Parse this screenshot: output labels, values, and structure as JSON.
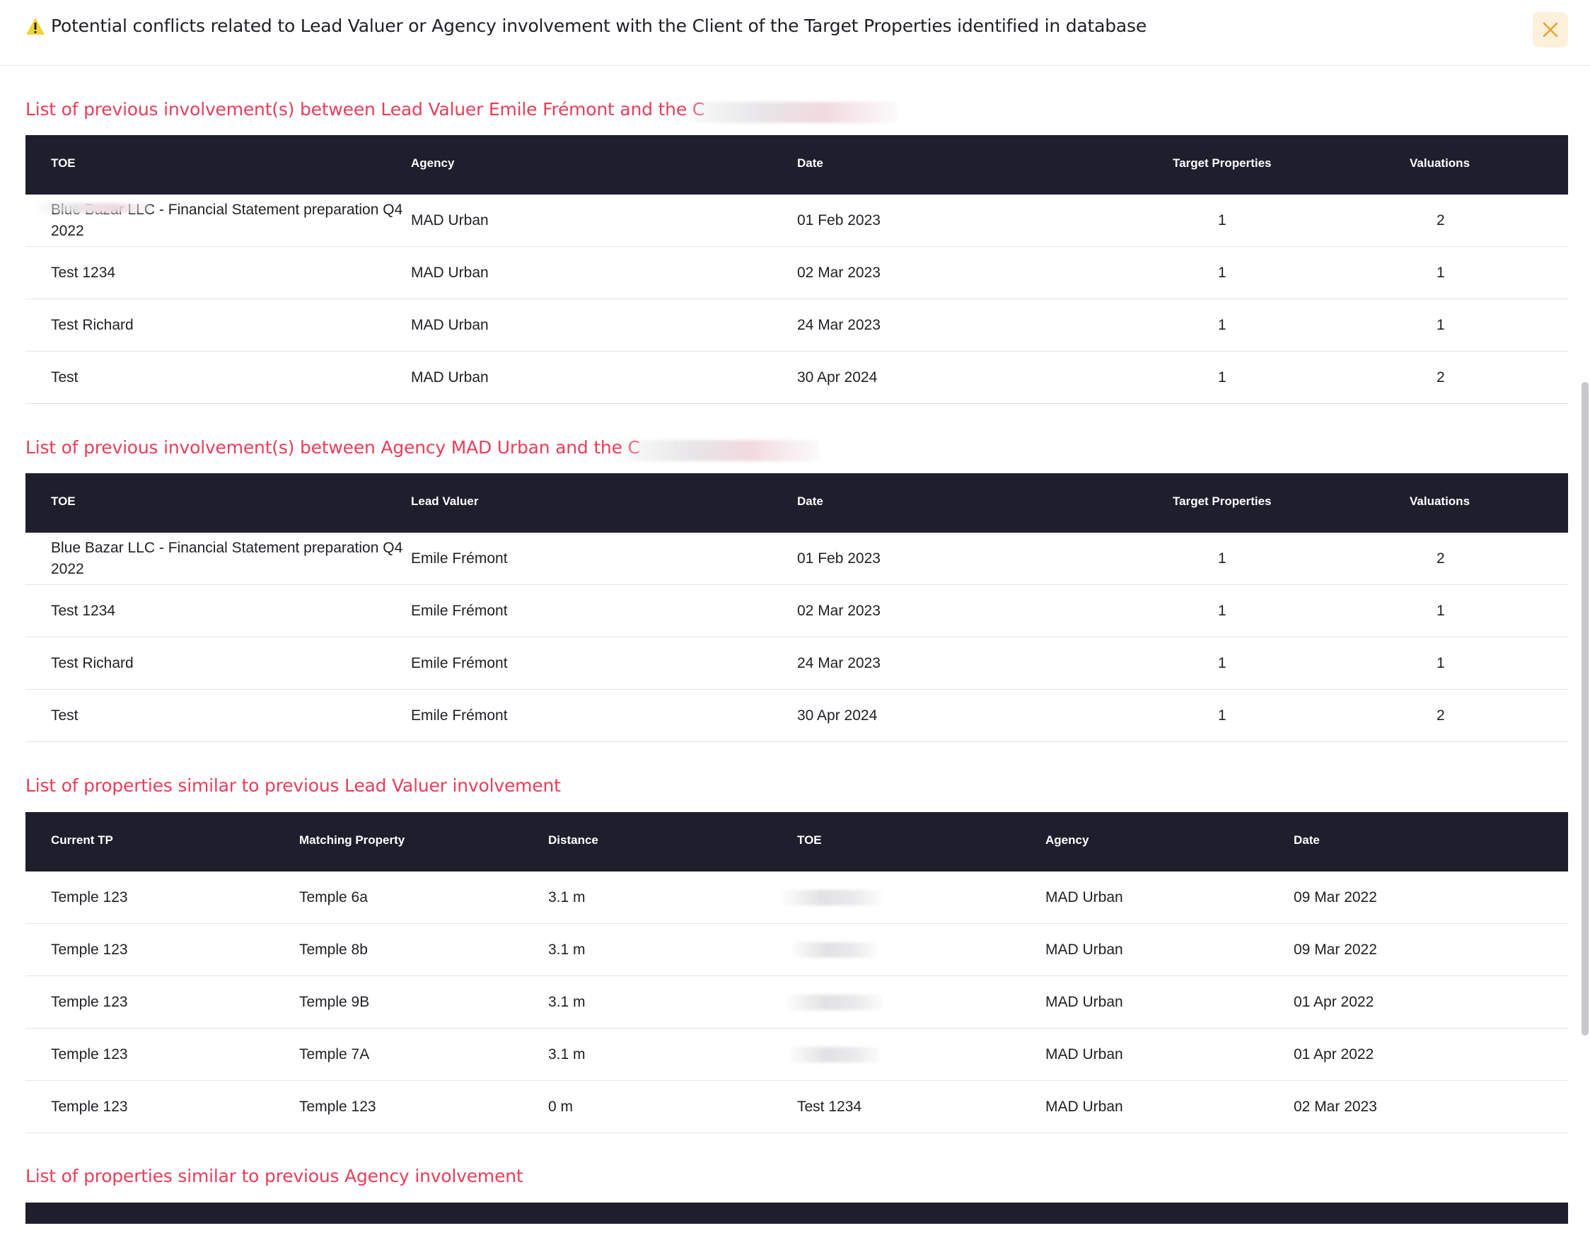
{
  "header": {
    "title": "Potential conflicts related to Lead Valuer or Agency involvement with the Client of the Target Properties identified in database",
    "warning_color": "#f2c94c",
    "close_icon": "close-icon",
    "accent": "#f2a02b"
  },
  "sections": {
    "valuer_involvement": {
      "title": "List of previous involvement(s) between Lead Valuer Emile Frémont and the C",
      "columns": [
        "TOE",
        "Agency",
        "Date",
        "Target Properties",
        "Valuations"
      ],
      "rows": [
        {
          "toe_line1": "Blue Bazar LLC - Financial Statement preparation Q4",
          "toe_line2": "2022",
          "agency": "MAD Urban",
          "date": "01 Feb 2023",
          "target_properties": "1",
          "valuations": "2"
        },
        {
          "toe": "Test 1234",
          "agency": "MAD Urban",
          "date": "02 Mar 2023",
          "target_properties": "1",
          "valuations": "1"
        },
        {
          "toe": "Test Richard",
          "agency": "MAD Urban",
          "date": "24 Mar 2023",
          "target_properties": "1",
          "valuations": "1"
        },
        {
          "toe": "Test",
          "agency": "MAD Urban",
          "date": "30 Apr 2024",
          "target_properties": "1",
          "valuations": "2"
        }
      ]
    },
    "agency_involvement": {
      "title": "List of previous involvement(s) between Agency MAD Urban and the C",
      "columns": [
        "TOE",
        "Lead Valuer",
        "Date",
        "Target Properties",
        "Valuations"
      ],
      "rows": [
        {
          "toe_line1": "Blue Bazar LLC - Financial Statement preparation Q4",
          "toe_line2": "2022",
          "lead_valuer": "Emile Frémont",
          "date": "01 Feb 2023",
          "target_properties": "1",
          "valuations": "2"
        },
        {
          "toe": "Test 1234",
          "lead_valuer": "Emile Frémont",
          "date": "02 Mar 2023",
          "target_properties": "1",
          "valuations": "1"
        },
        {
          "toe": "Test Richard",
          "lead_valuer": "Emile Frémont",
          "date": "24 Mar 2023",
          "target_properties": "1",
          "valuations": "1"
        },
        {
          "toe": "Test",
          "lead_valuer": "Emile Frémont",
          "date": "30 Apr 2024",
          "target_properties": "1",
          "valuations": "2"
        }
      ]
    },
    "similar_valuer": {
      "title": "List of properties similar to previous Lead Valuer involvement",
      "columns": [
        "Current TP",
        "Matching Property",
        "Distance",
        "TOE",
        "Agency",
        "Date"
      ],
      "rows": [
        {
          "current_tp": "Temple 123",
          "matching_property": "Temple 6a",
          "distance": "3.1 m",
          "toe": "",
          "agency": "MAD Urban",
          "date": "09 Mar 2022"
        },
        {
          "current_tp": "Temple 123",
          "matching_property": "Temple 8b",
          "distance": "3.1 m",
          "toe": "",
          "agency": "MAD Urban",
          "date": "09 Mar 2022"
        },
        {
          "current_tp": "Temple 123",
          "matching_property": "Temple 9B",
          "distance": "3.1 m",
          "toe": "",
          "agency": "MAD Urban",
          "date": "01 Apr 2022"
        },
        {
          "current_tp": "Temple 123",
          "matching_property": "Temple 7A",
          "distance": "3.1 m",
          "toe": "",
          "agency": "MAD Urban",
          "date": "01 Apr 2022"
        },
        {
          "current_tp": "Temple 123",
          "matching_property": "Temple 123",
          "distance": "0 m",
          "toe": "Test 1234",
          "agency": "MAD Urban",
          "date": "02 Mar 2023"
        }
      ]
    },
    "similar_agency": {
      "title": "List of properties similar to previous Agency involvement"
    }
  }
}
